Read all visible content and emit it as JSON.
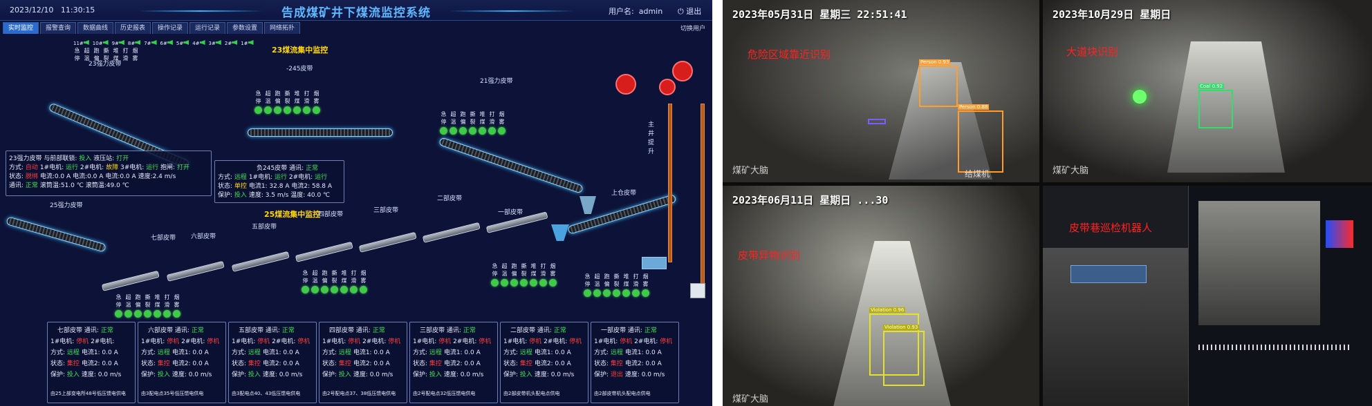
{
  "scada": {
    "date": "2023/12/10",
    "time": "11:30:15",
    "title": "告成煤矿井下煤流监控系统",
    "user_label": "用户名:",
    "user": "admin",
    "logout": "退出",
    "tabs": [
      "实时监控",
      "报警查询",
      "数据曲线",
      "历史报表",
      "操作记录",
      "运行记录",
      "参数设置",
      "网络拓扑"
    ],
    "switch_user": "切换用户",
    "hdr_23": "23煤流集中监控",
    "hdr_25": "25煤流集中监控",
    "sig_labels": [
      "急停",
      "超温",
      "跑偏",
      "撕裂",
      "堆煤",
      "打滑",
      "烟雾"
    ],
    "spk_labels": [
      "11#",
      "10#",
      "9#",
      "8#",
      "7#",
      "6#",
      "5#",
      "4#",
      "3#",
      "2#",
      "1#"
    ],
    "belt_labels": {
      "b23": "23强力皮带",
      "b245": "-245皮带",
      "b21": "21强力皮带",
      "b25": "25强力皮带",
      "b7": "七部皮带",
      "b6": "六部皮带",
      "b5": "五部皮带",
      "b4": "四部皮带",
      "b3": "三部皮带",
      "b2": "二部皮带",
      "b1": "一部皮带",
      "shang": "上仓皮带",
      "shaft": "主井提升"
    },
    "p23": {
      "t1": "23强力皮带",
      "t2": "与前部联锁:",
      "t2v": "投入",
      "t3": "液压站:",
      "t3v": "打开",
      "mode": "方式:",
      "modev": "自动",
      "m1": "1#电机:",
      "m1v": "运行",
      "m2": "2#电机:",
      "m2v": "故障",
      "m3": "3#电机:",
      "m3v": "运行",
      "brake": "抱闸:",
      "brakev": "打开",
      "state": "状态:",
      "statev": "脱绑",
      "i1": "电流:0.0 A",
      "i2": "电流:0.0 A",
      "i3": "电流:0.0 A",
      "spd": "速度:2.4 m/s",
      "com": "通讯:",
      "comv": "正常",
      "tmp1": "滚筒温:51.0 ℃",
      "tmp2": "滚筒温:49.0 ℃"
    },
    "p245": {
      "title": "负245皮带",
      "com": "通讯:",
      "comv": "正常",
      "mode": "方式:",
      "modev": "远程",
      "m1": "1#电机:",
      "m1v": "运行",
      "m2": "2#电机:",
      "m2v": "运行",
      "state": "状态:",
      "statev": "单控",
      "i1": "电流1: 32.8 A",
      "i2": "电流2: 58.8 A",
      "prot": "保护:",
      "protv": "投入",
      "spd": "速度: 3.5 m/s",
      "tmp": "温度: 40.0 ℃"
    },
    "panels": [
      {
        "title": "七部皮带",
        "comv": "正常",
        "modev": "远程",
        "statev": "集控",
        "protv": "投入",
        "m1v": "停机",
        "m2v": "",
        "i1": "电流1: 0.0 A",
        "i2": "电流2: 0.0 A",
        "spd": "速度: 0.0 m/s",
        "foot": "由25上部变电所48号低压馈电供电"
      },
      {
        "title": "六部皮带",
        "comv": "正常",
        "modev": "远程",
        "statev": "集控",
        "protv": "投入",
        "m1v": "停机",
        "m2v": "停机",
        "i1": "电流1: 0.0 A",
        "i2": "电流2: 0.0 A",
        "spd": "速度: 0.0 m/s",
        "foot": "由3配电点35号低压馈电供电"
      },
      {
        "title": "五部皮带",
        "comv": "正常",
        "modev": "远程",
        "statev": "集控",
        "protv": "投入",
        "m1v": "停机",
        "m2v": "停机",
        "i1": "电流1: 0.0 A",
        "i2": "电流2: 0.0 A",
        "spd": "速度: 0.0 m/s",
        "foot": "由3配电点40、43低压馈电供电"
      },
      {
        "title": "四部皮带",
        "comv": "正常",
        "modev": "远程",
        "statev": "集控",
        "protv": "投入",
        "m1v": "停机",
        "m2v": "停机",
        "i1": "电流1: 0.0 A",
        "i2": "电流2: 0.0 A",
        "spd": "速度: 0.0 m/s",
        "foot": "由2号配电点37、38低压馈电供电"
      },
      {
        "title": "三部皮带",
        "comv": "正常",
        "modev": "远程",
        "statev": "集控",
        "protv": "投入",
        "m1v": "停机",
        "m2v": "停机",
        "i1": "电流1: 0.0 A",
        "i2": "电流2: 0.0 A",
        "spd": "速度: 0.0 m/s",
        "foot": "由2号配电点32低压馈电供电"
      },
      {
        "title": "二部皮带",
        "comv": "正常",
        "modev": "远程",
        "statev": "集控",
        "protv": "投入",
        "m1v": "停机",
        "m2v": "停机",
        "i1": "电流1: 0.0 A",
        "i2": "电流2: 0.0 A",
        "spd": "速度: 0.0 m/s",
        "foot": "由2部皮带机头配电点供电"
      },
      {
        "title": "一部皮带",
        "comv": "正常",
        "modev": "远程",
        "statev": "集控",
        "protv": "退出",
        "m1v": "停机",
        "m2v": "停机",
        "i1": "电流1: 0.0 A",
        "i2": "电流2: 0.0 A",
        "spd": "速度: 0.0 m/s",
        "foot": "由2部皮带机头配电点供电"
      }
    ],
    "panel_keys": {
      "com": "通讯:",
      "mode": "方式:",
      "state": "状态:",
      "prot": "保护:",
      "m1": "1#电机:",
      "m2": "2#电机:"
    }
  },
  "cams": [
    {
      "ts": "2023年05月31日 星期三 22:51:41",
      "cap": "危险区域靠近识别",
      "wm": "煤矿大脑",
      "box1": "Person 0.93",
      "box2": "Person 0.88",
      "extra": "给煤机"
    },
    {
      "ts": "2023年10月29日 星期日",
      "cap": "大道块识别",
      "wm": "煤矿大脑",
      "box1": "Coal 0.92"
    },
    {
      "ts": "2023年06月11日 星期日 ...30",
      "cap": "皮带异物识别",
      "wm": "煤矿大脑",
      "box1": "Violation 0.96",
      "box2": "Violation 0.93"
    },
    {
      "cap": "皮带巷巡检机器人"
    }
  ],
  "colors": {
    "bg": "#0d1338",
    "ok": "#3fe05a",
    "alarm": "#ff3b3b",
    "title": "#5fb8ff",
    "header": "#ffd60a"
  }
}
